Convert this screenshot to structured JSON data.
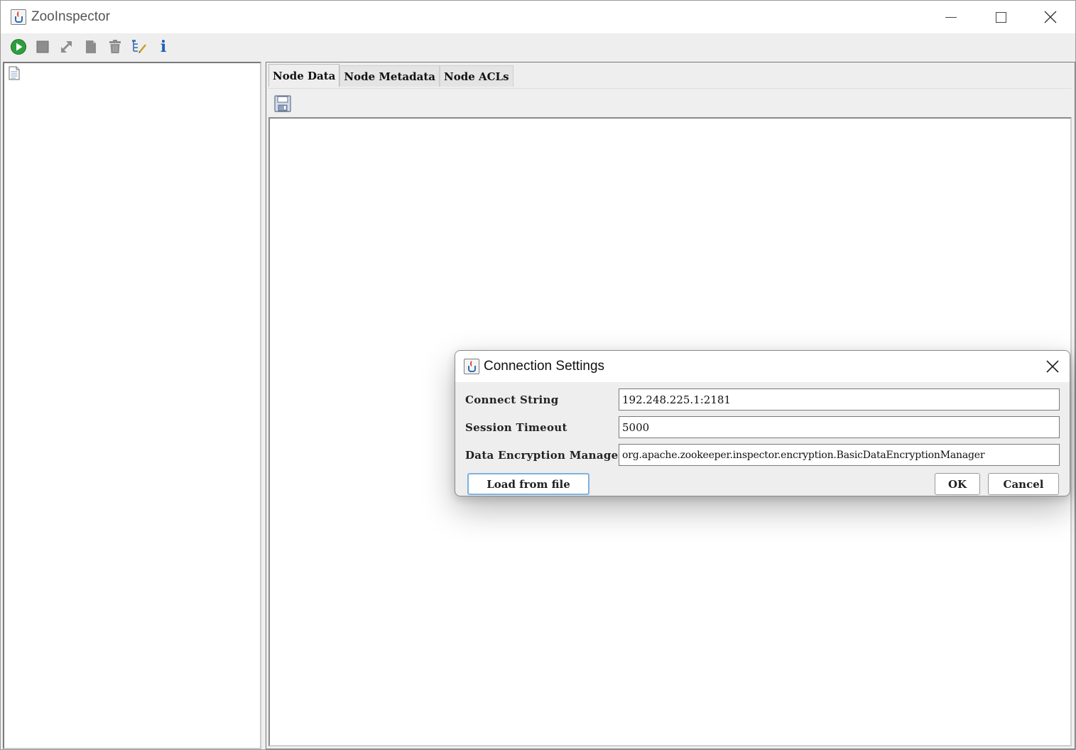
{
  "window": {
    "title": "ZooInspector",
    "accent_color": "#2a6db5"
  },
  "toolbar": {
    "buttons": [
      {
        "name": "connect",
        "icon": "play-icon"
      },
      {
        "name": "disconnect",
        "icon": "stop-icon"
      },
      {
        "name": "refresh",
        "icon": "refresh-icon"
      },
      {
        "name": "add-node",
        "icon": "document-icon"
      },
      {
        "name": "delete-node",
        "icon": "trash-icon"
      },
      {
        "name": "node-viewers",
        "icon": "tree-edit-icon"
      },
      {
        "name": "about",
        "icon": "info-icon"
      }
    ],
    "about_label": "i"
  },
  "tabs": [
    {
      "label": "Node Data",
      "active": true
    },
    {
      "label": "Node Metadata",
      "active": false
    },
    {
      "label": "Node ACLs",
      "active": false
    }
  ],
  "dialog": {
    "title": "Connection Settings",
    "fields": {
      "connect_string": {
        "label": "Connect String",
        "value": "192.248.225.1:2181"
      },
      "session_timeout": {
        "label": "Session Timeout",
        "value": "5000"
      },
      "encryption_manager": {
        "label": "Data Encryption Manager",
        "value": "org.apache.zookeeper.inspector.encryption.BasicDataEncryptionManager"
      }
    },
    "buttons": {
      "load": "Load from file",
      "ok": "OK",
      "cancel": "Cancel"
    }
  }
}
